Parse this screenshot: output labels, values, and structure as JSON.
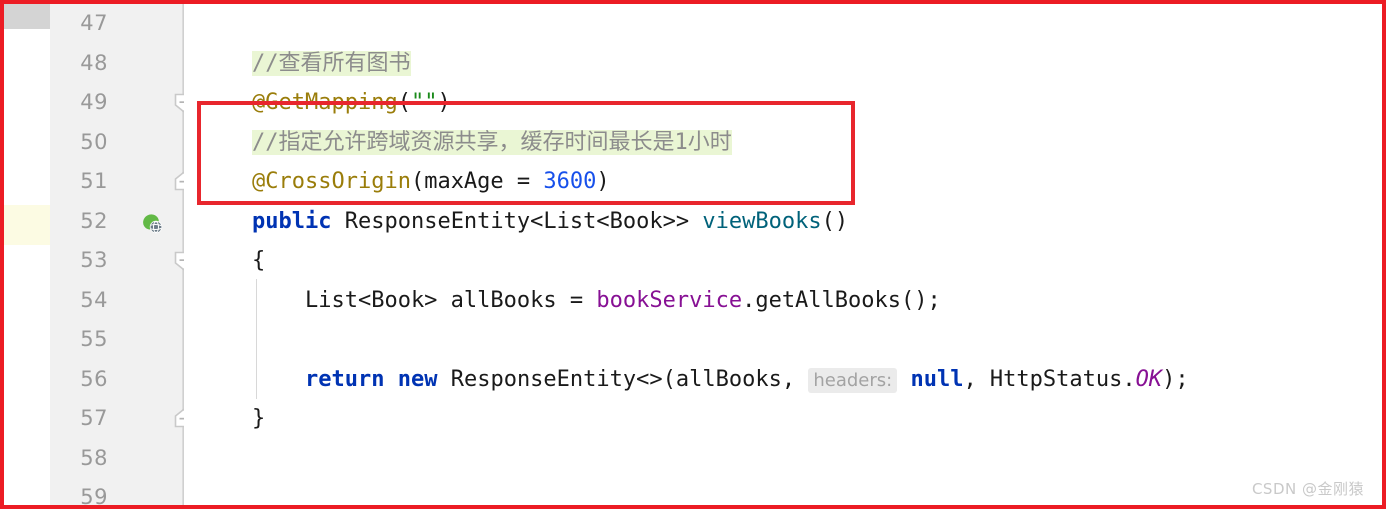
{
  "editor": {
    "app": "intellij-idea-java-editor",
    "first_line_number": 47,
    "gutter": [
      {
        "num": "47",
        "icon": "",
        "fold": ""
      },
      {
        "num": "48",
        "icon": "",
        "fold": ""
      },
      {
        "num": "49",
        "icon": "",
        "fold": "collapse-down"
      },
      {
        "num": "50",
        "icon": "",
        "fold": ""
      },
      {
        "num": "51",
        "icon": "",
        "fold": "collapse-up"
      },
      {
        "num": "52",
        "icon": "spring-web-endpoint-icon",
        "fold": ""
      },
      {
        "num": "53",
        "icon": "",
        "fold": "collapse-down"
      },
      {
        "num": "54",
        "icon": "",
        "fold": ""
      },
      {
        "num": "55",
        "icon": "",
        "fold": ""
      },
      {
        "num": "56",
        "icon": "",
        "fold": ""
      },
      {
        "num": "57",
        "icon": "",
        "fold": "collapse-up"
      },
      {
        "num": "58",
        "icon": "",
        "fold": ""
      },
      {
        "num": "59",
        "icon": "",
        "fold": ""
      }
    ],
    "lines": [
      {
        "number": "47",
        "tokens": []
      },
      {
        "number": "48",
        "tokens": [
          {
            "t": "//查看所有图书",
            "c": "tok-comment"
          }
        ]
      },
      {
        "number": "49",
        "tokens": [
          {
            "t": "@GetMapping",
            "c": "tok-annot"
          },
          {
            "t": "(",
            "c": "tok-plain"
          },
          {
            "t": "\"\"",
            "c": "tok-string"
          },
          {
            "t": ")",
            "c": "tok-plain"
          }
        ]
      },
      {
        "number": "50",
        "tokens": [
          {
            "t": "//指定允许跨域资源共享，缓存时间最长是1小时",
            "c": "tok-comment"
          }
        ]
      },
      {
        "number": "51",
        "tokens": [
          {
            "t": "@CrossOrigin",
            "c": "tok-annot"
          },
          {
            "t": "(maxAge = ",
            "c": "tok-plain"
          },
          {
            "t": "3600",
            "c": "tok-number"
          },
          {
            "t": ")",
            "c": "tok-plain"
          }
        ]
      },
      {
        "number": "52",
        "tokens": [
          {
            "t": "public",
            "c": "tok-keyword"
          },
          {
            "t": " ResponseEntity<List<Book>> ",
            "c": "tok-plain"
          },
          {
            "t": "viewBooks",
            "c": "tok-method"
          },
          {
            "t": "()",
            "c": "tok-plain"
          }
        ]
      },
      {
        "number": "53",
        "tokens": [
          {
            "t": "{",
            "c": "tok-plain"
          }
        ]
      },
      {
        "number": "54",
        "tokens": [
          {
            "t": "    List<Book> allBooks = ",
            "c": "tok-plain"
          },
          {
            "t": "bookService",
            "c": "tok-field"
          },
          {
            "t": ".getAllBooks();",
            "c": "tok-plain"
          }
        ]
      },
      {
        "number": "55",
        "tokens": []
      },
      {
        "number": "56",
        "tokens": [
          {
            "t": "    ",
            "c": "tok-plain"
          },
          {
            "t": "return",
            "c": "tok-keyword"
          },
          {
            "t": " ",
            "c": "tok-plain"
          },
          {
            "t": "new",
            "c": "tok-keyword"
          },
          {
            "t": " ResponseEntity<>(allBooks, ",
            "c": "tok-plain"
          },
          {
            "t": "headers:",
            "c": "tok-hint"
          },
          {
            "t": " ",
            "c": "tok-plain"
          },
          {
            "t": "null",
            "c": "tok-keyword"
          },
          {
            "t": ", HttpStatus.",
            "c": "tok-plain"
          },
          {
            "t": "OK",
            "c": "tok-static"
          },
          {
            "t": ");",
            "c": "tok-plain"
          }
        ]
      },
      {
        "number": "57",
        "tokens": [
          {
            "t": "}",
            "c": "tok-plain"
          }
        ]
      },
      {
        "number": "58",
        "tokens": []
      },
      {
        "number": "59",
        "tokens": []
      }
    ]
  },
  "annotation": {
    "outer_border_color": "#ec1c24",
    "inner_rect_color": "#e8262d",
    "inner_rect_covers_lines": "49-51"
  },
  "watermark": {
    "text": "CSDN @金刚猿",
    "color": "#c9c9c9"
  }
}
